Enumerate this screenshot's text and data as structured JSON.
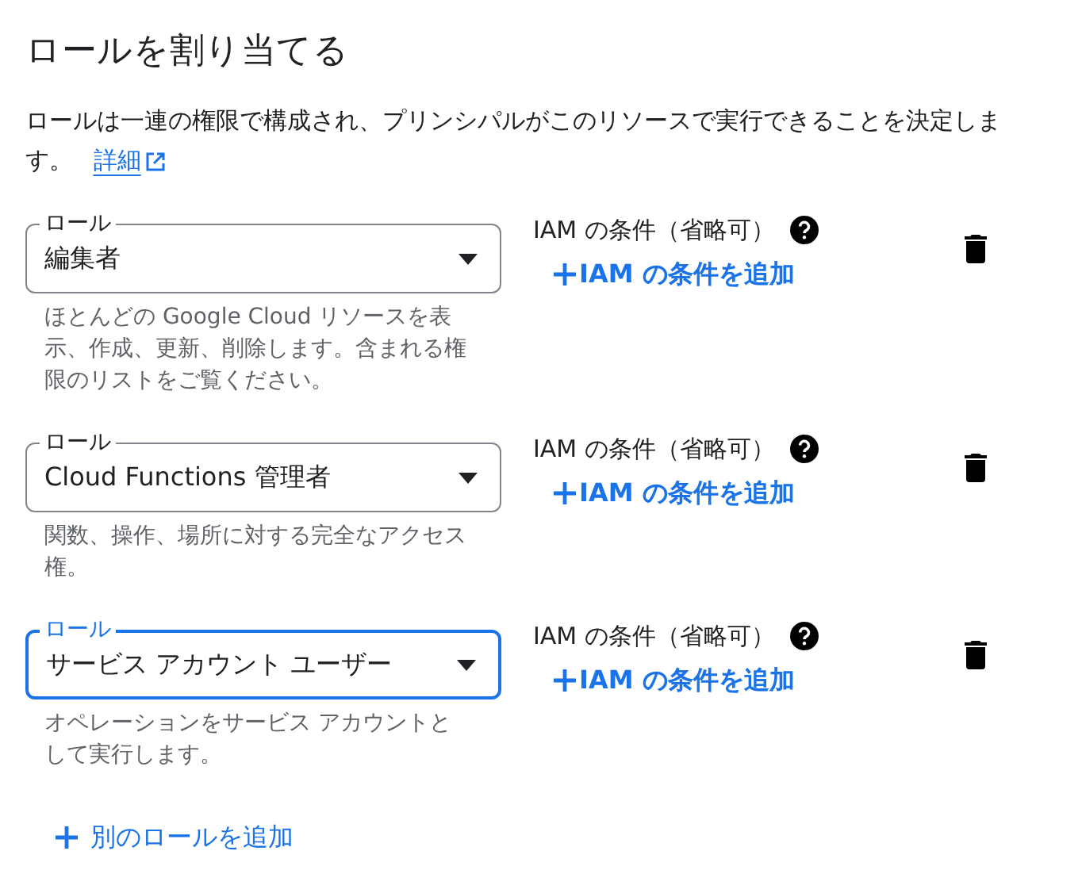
{
  "title": "ロールを割り当てる",
  "description": "ロールは一連の権限で構成され、プリンシパルがこのリソースで実行できることを決定します。",
  "details_link": "詳細",
  "roles": [
    {
      "label": "ロール",
      "value": "編集者",
      "focused": false,
      "helper": "ほとんどの Google Cloud リソースを表示、作成、更新、削除します。含まれる権限のリストをご覧ください。",
      "condition_label": "IAM の条件（省略可）",
      "add_condition": "IAM の条件を追加"
    },
    {
      "label": "ロール",
      "value": "Cloud Functions 管理者",
      "focused": false,
      "helper": "関数、操作、場所に対する完全なアクセス権。",
      "condition_label": "IAM の条件（省略可）",
      "add_condition": "IAM の条件を追加"
    },
    {
      "label": "ロール",
      "value": "サービス アカウント ユーザー",
      "focused": true,
      "helper": "オペレーションをサービス アカウントとして実行します。",
      "condition_label": "IAM の条件（省略可）",
      "add_condition": "IAM の条件を追加"
    }
  ],
  "add_role": "別のロールを追加"
}
